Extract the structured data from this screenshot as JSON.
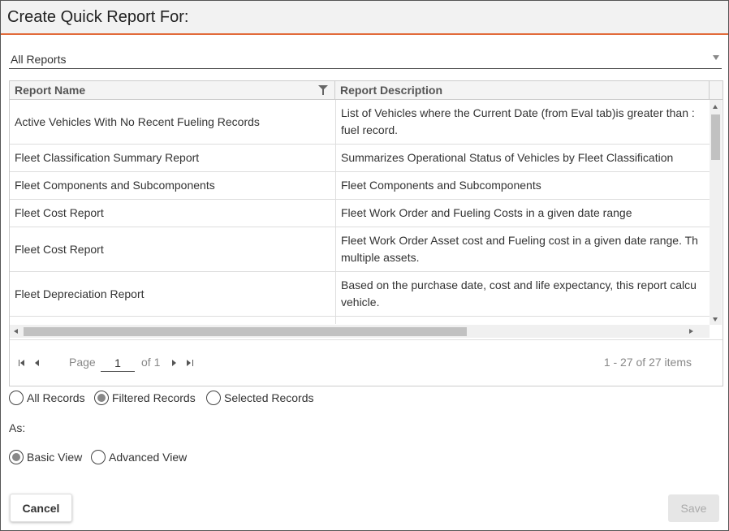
{
  "dialog": {
    "title": "Create Quick Report For:",
    "report_filter": {
      "selected": "All Reports"
    },
    "grid": {
      "columns": [
        "Report Name",
        "Report Description"
      ],
      "rows": [
        {
          "name": "Active Vehicles With No Recent Fueling Records",
          "desc1": "List of Vehicles where the Current Date (from Eval tab)is greater than :",
          "desc2": "fuel record."
        },
        {
          "name": "Fleet Classification Summary Report",
          "desc1": "Summarizes Operational Status of Vehicles by Fleet Classification",
          "desc2": ""
        },
        {
          "name": "Fleet Components and Subcomponents",
          "desc1": "Fleet Components and Subcomponents",
          "desc2": ""
        },
        {
          "name": "Fleet Cost Report",
          "desc1": "Fleet Work Order and Fueling Costs in a given date range",
          "desc2": ""
        },
        {
          "name": "Fleet Cost Report",
          "desc1": "Fleet Work Order Asset cost and Fueling cost in a given date range. Th",
          "desc2": "multiple assets."
        },
        {
          "name": "Fleet Depreciation Report",
          "desc1": "Based on the purchase date, cost and life expectancy, this report calcu",
          "desc2": "vehicle."
        }
      ]
    },
    "pager": {
      "page_label": "Page",
      "page_value": "1",
      "of_label": "of 1",
      "info": "1 - 27 of 27 items"
    },
    "records": {
      "all": "All Records",
      "filtered": "Filtered Records",
      "selected": "Selected Records",
      "checked": "filtered"
    },
    "as_label": "As:",
    "view": {
      "basic": "Basic View",
      "advanced": "Advanced View",
      "checked": "basic"
    },
    "buttons": {
      "cancel": "Cancel",
      "save": "Save"
    }
  },
  "colors": {
    "accent": "#e26b3a",
    "title_bg": "#f2f2f2"
  }
}
